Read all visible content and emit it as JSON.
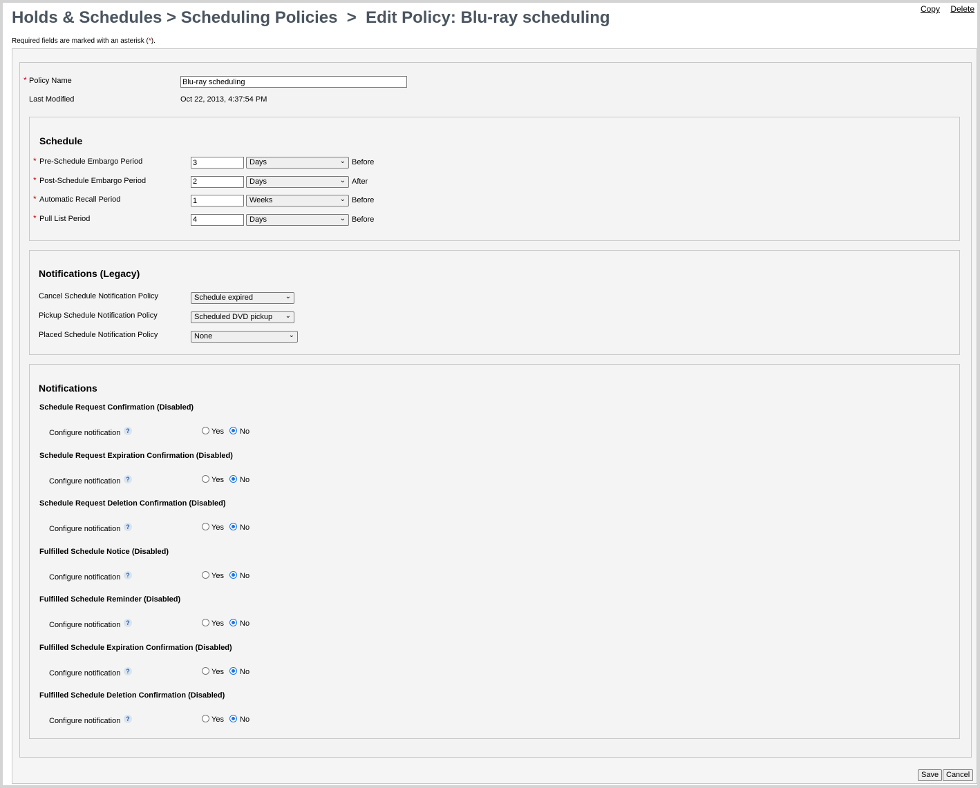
{
  "header": {
    "title": "Holds & Schedules > Scheduling Policies  >  Edit Policy: Blu-ray scheduling",
    "copy_link": "Copy",
    "delete_link": "Delete"
  },
  "required_note": {
    "before": "Required fields are marked with an asterisk (",
    "star": "*",
    "after": ")."
  },
  "policy": {
    "name_label": "Policy Name",
    "name_value": "Blu-ray scheduling",
    "last_modified_label": "Last Modified",
    "last_modified_value": "Oct 22, 2013, 4:37:54 PM"
  },
  "schedule": {
    "title": "Schedule",
    "rows": [
      {
        "label": "Pre-Schedule Embargo Period",
        "value": "3",
        "unit": "Days",
        "relation": "Before"
      },
      {
        "label": "Post-Schedule Embargo Period",
        "value": "2",
        "unit": "Days",
        "relation": "After"
      },
      {
        "label": "Automatic Recall Period",
        "value": "1",
        "unit": "Weeks",
        "relation": "Before"
      },
      {
        "label": "Pull List Period",
        "value": "4",
        "unit": "Days",
        "relation": "Before"
      }
    ]
  },
  "legacy": {
    "title": "Notifications (Legacy)",
    "rows": [
      {
        "label": "Cancel Schedule Notification Policy",
        "selected": "Schedule expired"
      },
      {
        "label": "Pickup Schedule Notification Policy",
        "selected": "Scheduled DVD pickup"
      },
      {
        "label": "Placed Schedule Notification Policy",
        "selected": "None"
      }
    ]
  },
  "notifications": {
    "title": "Notifications",
    "configure_label": "Configure notification",
    "help_glyph": "?",
    "yes_label": "Yes",
    "no_label": "No",
    "items": [
      {
        "title": "Schedule Request Confirmation (Disabled)",
        "selected": "No"
      },
      {
        "title": "Schedule Request Expiration Confirmation (Disabled)",
        "selected": "No"
      },
      {
        "title": "Schedule Request Deletion Confirmation (Disabled)",
        "selected": "No"
      },
      {
        "title": "Fulfilled Schedule Notice (Disabled)",
        "selected": "No"
      },
      {
        "title": "Fulfilled Schedule Reminder (Disabled)",
        "selected": "No"
      },
      {
        "title": "Fulfilled Schedule Expiration Confirmation (Disabled)",
        "selected": "No"
      },
      {
        "title": "Fulfilled Schedule Deletion Confirmation (Disabled)",
        "selected": "No"
      }
    ]
  },
  "footer": {
    "save_label": "Save",
    "cancel_label": "Cancel"
  },
  "colors": {
    "title_text": "#4a5560",
    "required_star": "#cc0000",
    "radio_checked": "#1a73e8"
  }
}
